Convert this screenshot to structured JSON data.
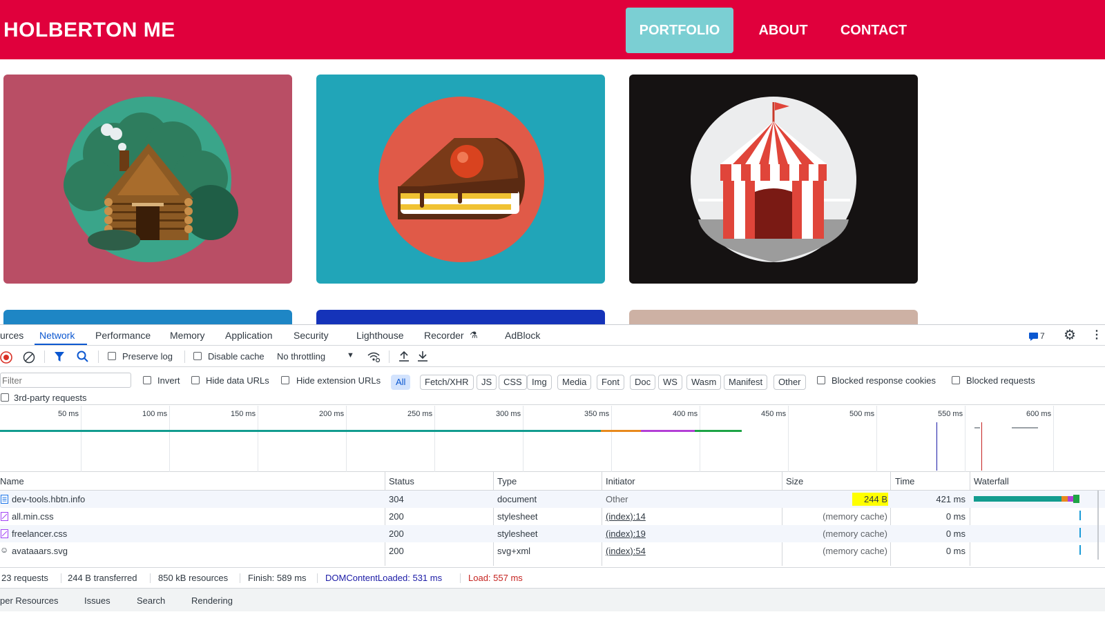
{
  "site": {
    "brand": "HOLBERTON ME",
    "nav": [
      {
        "label": "PORTFOLIO",
        "active": true
      },
      {
        "label": "ABOUT"
      },
      {
        "label": "CONTACT"
      }
    ],
    "colors": {
      "header": "#e0003c",
      "nav_active": "#7bcfd3"
    },
    "cards": [
      {
        "name": "log-cabin",
        "bg": "#b94e65"
      },
      {
        "name": "cake-slice",
        "bg": "#21a5b8"
      },
      {
        "name": "circus-tent",
        "bg": "#151212"
      },
      {
        "name": "blue",
        "bg": "#1e86c5"
      },
      {
        "name": "dark-blue",
        "bg": "#1533b9"
      },
      {
        "name": "tan",
        "bg": "#cdb1a4"
      }
    ]
  },
  "devtools": {
    "tabs": [
      "urces",
      "Network",
      "Performance",
      "Memory",
      "Application",
      "Security",
      "Lighthouse",
      "Recorder",
      "AdBlock"
    ],
    "active_tab": "Network",
    "issues_count": "7",
    "toolbar": {
      "preserve_log": "Preserve log",
      "disable_cache": "Disable cache",
      "throttling": "No throttling"
    },
    "filter": {
      "placeholder": "Filter",
      "invert": "Invert",
      "hide_data_urls": "Hide data URLs",
      "hide_extension_urls": "Hide extension URLs",
      "types": [
        "All",
        "Fetch/XHR",
        "JS",
        "CSS",
        "Img",
        "Media",
        "Font",
        "Doc",
        "WS",
        "Wasm",
        "Manifest",
        "Other"
      ],
      "active_type": "All",
      "blocked_response_cookies": "Blocked response cookies",
      "blocked_requests": "Blocked requests",
      "third_party": "3rd-party requests"
    },
    "timeline_ticks": [
      "50 ms",
      "100 ms",
      "150 ms",
      "200 ms",
      "250 ms",
      "300 ms",
      "350 ms",
      "400 ms",
      "450 ms",
      "500 ms",
      "550 ms",
      "600 ms"
    ],
    "columns": [
      "Name",
      "Status",
      "Type",
      "Initiator",
      "Size",
      "Time",
      "Waterfall"
    ],
    "requests": [
      {
        "name": "dev-tools.hbtn.info",
        "status": "304",
        "type": "document",
        "initiator": "Other",
        "size": "244 B",
        "time": "421 ms"
      },
      {
        "name": "all.min.css",
        "status": "200",
        "type": "stylesheet",
        "initiator": "(index):14",
        "size": "(memory cache)",
        "time": "0 ms"
      },
      {
        "name": "freelancer.css",
        "status": "200",
        "type": "stylesheet",
        "initiator": "(index):19",
        "size": "(memory cache)",
        "time": "0 ms"
      },
      {
        "name": "avataaars.svg",
        "status": "200",
        "type": "svg+xml",
        "initiator": "(index):54",
        "size": "(memory cache)",
        "time": "0 ms"
      }
    ],
    "summary": {
      "requests": "23 requests",
      "transferred": "244 B transferred",
      "resources": "850 kB resources",
      "finish": "Finish: 589 ms",
      "dom_content_loaded": "DOMContentLoaded: 531 ms",
      "load": "Load: 557 ms"
    },
    "drawer_tabs": [
      "per Resources",
      "Issues",
      "Search",
      "Rendering"
    ],
    "colors": {
      "accent": "#0b57d0",
      "dcl": "#1a1aa6",
      "load": "#c5221f",
      "highlight": "#ffff00"
    }
  }
}
